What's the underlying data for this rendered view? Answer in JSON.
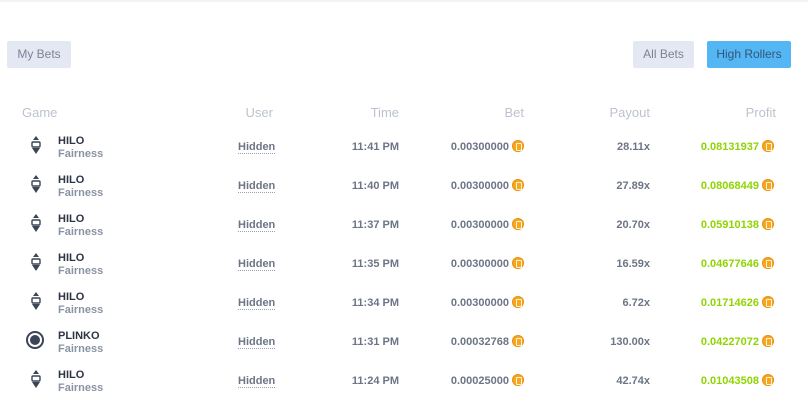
{
  "buttons": {
    "my_bets": "My Bets",
    "all_bets": "All Bets",
    "high_rollers": "High Rollers"
  },
  "columns": {
    "game": "Game",
    "user": "User",
    "time": "Time",
    "bet": "Bet",
    "payout": "Payout",
    "profit": "Profit"
  },
  "rows": [
    {
      "game": "HILO",
      "sub": "Fairness",
      "user": "Hidden",
      "time": "11:41 PM",
      "bet": "0.00300000",
      "payout": "28.11x",
      "profit": "0.08131937",
      "icon": "hilo-icon"
    },
    {
      "game": "HILO",
      "sub": "Fairness",
      "user": "Hidden",
      "time": "11:40 PM",
      "bet": "0.00300000",
      "payout": "27.89x",
      "profit": "0.08068449",
      "icon": "hilo-icon"
    },
    {
      "game": "HILO",
      "sub": "Fairness",
      "user": "Hidden",
      "time": "11:37 PM",
      "bet": "0.00300000",
      "payout": "20.70x",
      "profit": "0.05910138",
      "icon": "hilo-icon"
    },
    {
      "game": "HILO",
      "sub": "Fairness",
      "user": "Hidden",
      "time": "11:35 PM",
      "bet": "0.00300000",
      "payout": "16.59x",
      "profit": "0.04677646",
      "icon": "hilo-icon"
    },
    {
      "game": "HILO",
      "sub": "Fairness",
      "user": "Hidden",
      "time": "11:34 PM",
      "bet": "0.00300000",
      "payout": "6.72x",
      "profit": "0.01714626",
      "icon": "hilo-icon"
    },
    {
      "game": "PLINKO",
      "sub": "Fairness",
      "user": "Hidden",
      "time": "11:31 PM",
      "bet": "0.00032768",
      "payout": "130.00x",
      "profit": "0.04227072",
      "icon": "plinko-icon"
    },
    {
      "game": "HILO",
      "sub": "Fairness",
      "user": "Hidden",
      "time": "11:24 PM",
      "bet": "0.00025000",
      "payout": "42.74x",
      "profit": "0.01043508",
      "icon": "hilo-icon"
    }
  ],
  "colors": {
    "profit": "#8fd400",
    "coin": "#f5a623",
    "active_tab": "#55b6f4"
  }
}
